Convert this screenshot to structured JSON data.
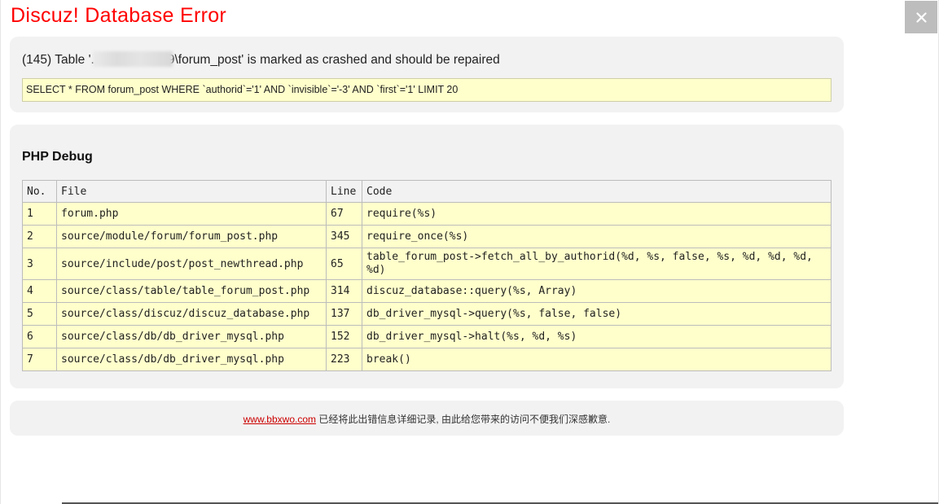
{
  "window": {
    "title": "Discuz! Database Error",
    "close_label": "×"
  },
  "error": {
    "message_prefix": "(145) Table '.",
    "message_suffix": "9\\forum_post' is marked as crashed and should be repaired",
    "sql": "SELECT * FROM forum_post WHERE `authorid`='1' AND `invisible`='-3' AND `first`='1' LIMIT 20"
  },
  "debug": {
    "title": "PHP Debug",
    "headers": [
      "No.",
      "File",
      "Line",
      "Code"
    ],
    "rows": [
      {
        "no": "1",
        "file": "forum.php",
        "line": "67",
        "code": "require(%s)"
      },
      {
        "no": "2",
        "file": "source/module/forum/forum_post.php",
        "line": "345",
        "code": "require_once(%s)"
      },
      {
        "no": "3",
        "file": "source/include/post/post_newthread.php",
        "line": "65",
        "code": "table_forum_post->fetch_all_by_authorid(%d, %s, false, %s, %d, %d, %d, %d)"
      },
      {
        "no": "4",
        "file": "source/class/table/table_forum_post.php",
        "line": "314",
        "code": "discuz_database::query(%s, Array)"
      },
      {
        "no": "5",
        "file": "source/class/discuz/discuz_database.php",
        "line": "137",
        "code": "db_driver_mysql->query(%s, false, false)"
      },
      {
        "no": "6",
        "file": "source/class/db/db_driver_mysql.php",
        "line": "152",
        "code": "db_driver_mysql->halt(%s, %d, %s)"
      },
      {
        "no": "7",
        "file": "source/class/db/db_driver_mysql.php",
        "line": "223",
        "code": "break()"
      }
    ]
  },
  "footer": {
    "link_text": "www.bbxwo.com",
    "message": " 已经将此出错信息详细记录, 由此给您带来的访问不便我们深感歉意."
  },
  "colors": {
    "title": "#ff0000",
    "highlight_bg": "#ffffcc",
    "panel_bg": "#f2f2f2",
    "close_bg": "#bdbdbd",
    "link": "#cc0000"
  },
  "icons": {
    "close": "close-icon"
  }
}
